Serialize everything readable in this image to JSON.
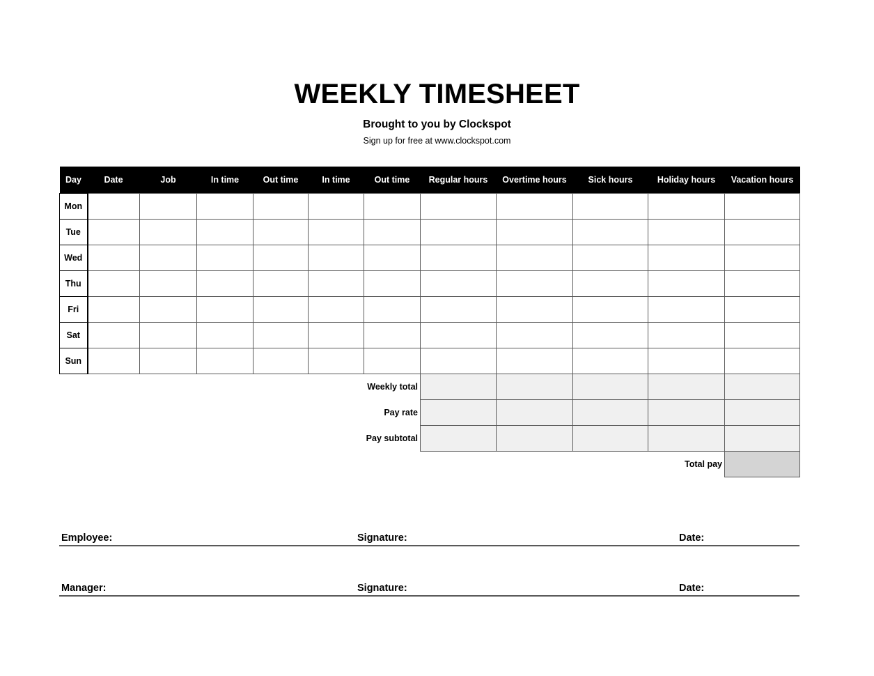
{
  "document": {
    "title": "WEEKLY TIMESHEET",
    "subtitle": "Brought to you by Clockspot",
    "tagline": "Sign up for free at www.clockspot.com"
  },
  "table": {
    "headers": [
      "Day",
      "Date",
      "Job",
      "In time",
      "Out time",
      "In time",
      "Out time",
      "Regular hours",
      "Overtime hours",
      "Sick hours",
      "Holiday hours",
      "Vacation hours"
    ],
    "rows": [
      {
        "day": "Mon",
        "date": "",
        "job": "",
        "in_time_1": "",
        "out_time_1": "",
        "in_time_2": "",
        "out_time_2": "",
        "regular_hours": "",
        "overtime_hours": "",
        "sick_hours": "",
        "holiday_hours": "",
        "vacation_hours": ""
      },
      {
        "day": "Tue",
        "date": "",
        "job": "",
        "in_time_1": "",
        "out_time_1": "",
        "in_time_2": "",
        "out_time_2": "",
        "regular_hours": "",
        "overtime_hours": "",
        "sick_hours": "",
        "holiday_hours": "",
        "vacation_hours": ""
      },
      {
        "day": "Wed",
        "date": "",
        "job": "",
        "in_time_1": "",
        "out_time_1": "",
        "in_time_2": "",
        "out_time_2": "",
        "regular_hours": "",
        "overtime_hours": "",
        "sick_hours": "",
        "holiday_hours": "",
        "vacation_hours": ""
      },
      {
        "day": "Thu",
        "date": "",
        "job": "",
        "in_time_1": "",
        "out_time_1": "",
        "in_time_2": "",
        "out_time_2": "",
        "regular_hours": "",
        "overtime_hours": "",
        "sick_hours": "",
        "holiday_hours": "",
        "vacation_hours": ""
      },
      {
        "day": "Fri",
        "date": "",
        "job": "",
        "in_time_1": "",
        "out_time_1": "",
        "in_time_2": "",
        "out_time_2": "",
        "regular_hours": "",
        "overtime_hours": "",
        "sick_hours": "",
        "holiday_hours": "",
        "vacation_hours": ""
      },
      {
        "day": "Sat",
        "date": "",
        "job": "",
        "in_time_1": "",
        "out_time_1": "",
        "in_time_2": "",
        "out_time_2": "",
        "regular_hours": "",
        "overtime_hours": "",
        "sick_hours": "",
        "holiday_hours": "",
        "vacation_hours": ""
      },
      {
        "day": "Sun",
        "date": "",
        "job": "",
        "in_time_1": "",
        "out_time_1": "",
        "in_time_2": "",
        "out_time_2": "",
        "regular_hours": "",
        "overtime_hours": "",
        "sick_hours": "",
        "holiday_hours": "",
        "vacation_hours": ""
      }
    ],
    "summary": {
      "weekly_total": {
        "label": "Weekly total",
        "values": [
          "",
          "",
          "",
          "",
          ""
        ]
      },
      "pay_rate": {
        "label": "Pay rate",
        "values": [
          "",
          "",
          "",
          "",
          ""
        ]
      },
      "pay_subtotal": {
        "label": "Pay subtotal",
        "values": [
          "",
          "",
          "",
          "",
          ""
        ]
      },
      "total_pay": {
        "label": "Total pay",
        "value": ""
      }
    }
  },
  "signatures": {
    "employee": {
      "name_label": "Employee:",
      "name_value": "",
      "signature_label": "Signature:",
      "signature_value": "",
      "date_label": "Date:",
      "date_value": ""
    },
    "manager": {
      "name_label": "Manager:",
      "name_value": "",
      "signature_label": "Signature:",
      "signature_value": "",
      "date_label": "Date:",
      "date_value": ""
    }
  },
  "colors": {
    "header_bar": "#000000",
    "grid_line": "#595959",
    "summary_cell": "#f0f0f0",
    "total_pay_cell": "#d4d4d4",
    "page_background": "#ffffff"
  }
}
